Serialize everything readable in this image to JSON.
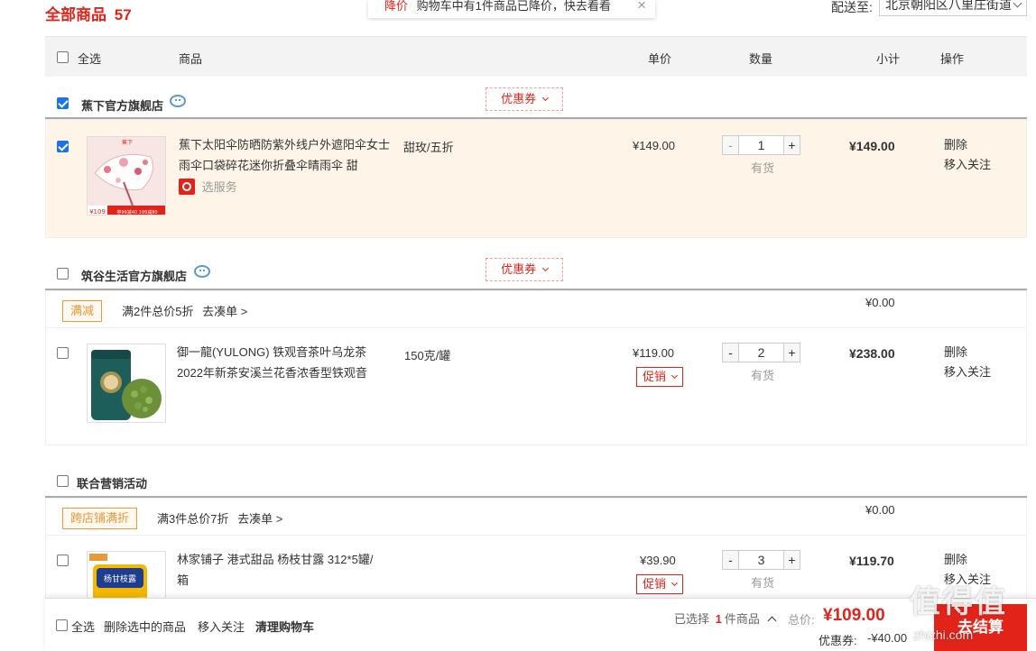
{
  "header": {
    "all_goods_label": "全部商品",
    "all_goods_count": "57",
    "notice_tag": "降价",
    "notice_text": "购物车中有1件商品已降价，快去看看",
    "notice_close": "×",
    "ship_label": "配送至:",
    "ship_address": "北京朝阳区八里庄街道"
  },
  "table_header": {
    "select_all": "全选",
    "product": "商品",
    "unit_price": "单价",
    "quantity": "数量",
    "subtotal": "小计",
    "actions": "操作"
  },
  "shops": [
    {
      "name": "蕉下官方旗舰店",
      "checked": true,
      "coupon": "优惠券",
      "items": [
        {
          "checked": true,
          "title": "蕉下太阳伞防晒防紫外线户外遮阳伞女士雨伞口袋碎花迷你折叠伞晴雨伞 甜",
          "attr": "甜玫/五折",
          "service": "选服务",
          "price": "¥149.00",
          "qty": "1",
          "stock": "有货",
          "subtotal": "¥149.00",
          "delete": "删除",
          "follow": "移入关注",
          "img_texts": [
            "蕉下",
            "¥109",
            "券99减40 199减80"
          ]
        }
      ]
    },
    {
      "name": "筑谷生活官方旗舰店",
      "checked": false,
      "coupon": "优惠券",
      "promo": {
        "tag": "满减",
        "text": "满2件总价5折",
        "link": "去凑单 >",
        "amount": "¥0.00"
      },
      "items": [
        {
          "checked": false,
          "title": "御一龍(YULONG) 铁观音茶叶乌龙茶2022年新茶安溪兰花香浓香型铁观音",
          "attr": "150克/罐",
          "price": "¥119.00",
          "promo_label": "促销",
          "qty": "2",
          "stock": "有货",
          "subtotal": "¥238.00",
          "delete": "删除",
          "follow": "移入关注"
        }
      ]
    },
    {
      "name": "联合营销活动",
      "checked": false,
      "promo": {
        "tag": "跨店铺满折",
        "text": "满3件总价7折",
        "link": "去凑单 >",
        "amount": "¥0.00"
      },
      "items": [
        {
          "checked": false,
          "title": "林家铺子 港式甜品 杨枝甘露 312*5罐/箱",
          "price": "¥39.90",
          "promo_label": "促销",
          "qty": "3",
          "stock": "有货",
          "subtotal": "¥119.70",
          "delete": "删除",
          "follow": "移入关注",
          "img_texts": [
            "杨甘枝露"
          ]
        }
      ]
    }
  ],
  "footer": {
    "select_all": "全选",
    "delete_selected": "删除选中的商品",
    "move_follow": "移入关注",
    "clear_cart": "清理购物车",
    "selected_prefix": "已选择",
    "selected_count": "1",
    "selected_suffix": "件商品",
    "total_label": "总价:",
    "total_value": "¥109.00",
    "discount_label": "优惠券:",
    "discount_value": "-¥40.00",
    "checkout": "去结算"
  },
  "watermark": {
    "text": "值得值",
    "url": "zhizhi.com"
  },
  "colors": {
    "accent_red": "#e2231a",
    "selected_bg": "#fff4e8",
    "checkbox_blue": "#1a73e8",
    "promo_orange": "#e8993a"
  }
}
